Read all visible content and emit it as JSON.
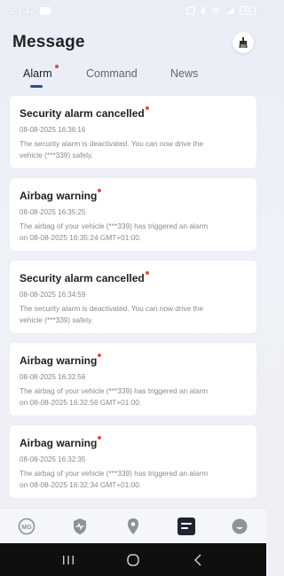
{
  "status_bar": {
    "time": "23:12",
    "battery": "41"
  },
  "header": {
    "title": "Message",
    "clear_icon": "broom-icon"
  },
  "tabs": [
    {
      "label": "Alarm",
      "active": true,
      "has_badge": true
    },
    {
      "label": "Command",
      "active": false,
      "has_badge": false
    },
    {
      "label": "News",
      "active": false,
      "has_badge": false
    }
  ],
  "messages": [
    {
      "title": "Security alarm cancelled",
      "time": "08-08-2025 16:36:16",
      "body_line1": "The security alarm is deactivated. You can now drive the",
      "body_line2": "vehicle (***339) safely."
    },
    {
      "title": "Airbag warning",
      "time": "08-08-2025 16:35:25",
      "body_line1": "The airbag of your vehicle (***339) has triggered an alarm",
      "body_line2": "on 08-08-2025 16:35:24 GMT+01:00."
    },
    {
      "title": "Security alarm cancelled",
      "time": "08-08-2025 16:34:59",
      "body_line1": "The security alarm is deactivated. You can now drive the",
      "body_line2": "vehicle (***339) safely."
    },
    {
      "title": "Airbag warning",
      "time": "08-08-2025 16:32:56",
      "body_line1": "The airbag of your vehicle (***339) has triggered an alarm",
      "body_line2": "on 08-08-2025 16:32:56 GMT+01:00."
    },
    {
      "title": "Airbag warning",
      "time": "08-08-2025 16:32:35",
      "body_line1": "The airbag of your vehicle (***339) has triggered an alarm",
      "body_line2": "on 08-08-2025 16:32:34 GMT+01:00."
    }
  ],
  "bottom_nav": [
    {
      "icon": "mg-logo-icon",
      "active": false
    },
    {
      "icon": "shield-pulse-icon",
      "active": false
    },
    {
      "icon": "location-pin-icon",
      "active": false
    },
    {
      "icon": "message-icon",
      "active": true
    },
    {
      "icon": "profile-face-icon",
      "active": false
    }
  ],
  "colors": {
    "accent": "#2f4d8f",
    "badge": "#e84545",
    "nav_icon": "#8c919a",
    "nav_icon_active": "#1f2430"
  }
}
